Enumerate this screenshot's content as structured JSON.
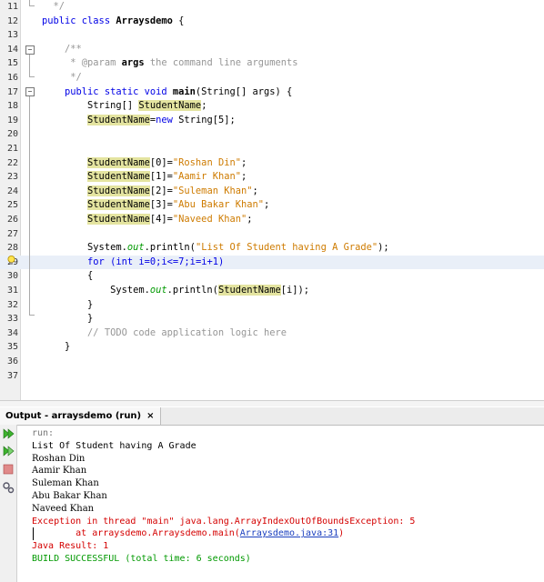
{
  "editor": {
    "lines": [
      {
        "n": "11",
        "parts": [
          {
            "t": "  */",
            "c": "com"
          }
        ]
      },
      {
        "n": "12",
        "parts": [
          {
            "t": "public class ",
            "c": "kw"
          },
          {
            "t": "Arraysdemo",
            "c": "bold"
          },
          {
            "t": " {",
            "c": ""
          }
        ]
      },
      {
        "n": "13",
        "parts": []
      },
      {
        "n": "14",
        "parts": [
          {
            "t": "    /**",
            "c": "com"
          }
        ]
      },
      {
        "n": "15",
        "parts": [
          {
            "t": "     * @param ",
            "c": "com"
          },
          {
            "t": "args",
            "c": "bold"
          },
          {
            "t": " the command line arguments",
            "c": "com"
          }
        ]
      },
      {
        "n": "16",
        "parts": [
          {
            "t": "     */",
            "c": "com"
          }
        ]
      },
      {
        "n": "17",
        "parts": [
          {
            "t": "    public static void ",
            "c": "kw"
          },
          {
            "t": "main",
            "c": "bold"
          },
          {
            "t": "(String[] args) {",
            "c": ""
          }
        ]
      },
      {
        "n": "18",
        "parts": [
          {
            "t": "        String[] ",
            "c": ""
          },
          {
            "t": "StudentName",
            "c": "var"
          },
          {
            "t": ";",
            "c": ""
          }
        ]
      },
      {
        "n": "19",
        "parts": [
          {
            "t": "        ",
            "c": ""
          },
          {
            "t": "StudentName",
            "c": "var"
          },
          {
            "t": "=",
            "c": ""
          },
          {
            "t": "new",
            "c": "kw"
          },
          {
            "t": " String[5];",
            "c": ""
          }
        ]
      },
      {
        "n": "20",
        "parts": []
      },
      {
        "n": "21",
        "parts": []
      },
      {
        "n": "22",
        "parts": [
          {
            "t": "        ",
            "c": ""
          },
          {
            "t": "StudentName",
            "c": "var"
          },
          {
            "t": "[0]=",
            "c": ""
          },
          {
            "t": "\"Roshan Din\"",
            "c": "str"
          },
          {
            "t": ";",
            "c": ""
          }
        ]
      },
      {
        "n": "23",
        "parts": [
          {
            "t": "        ",
            "c": ""
          },
          {
            "t": "StudentName",
            "c": "var"
          },
          {
            "t": "[1]=",
            "c": ""
          },
          {
            "t": "\"Aamir Khan\"",
            "c": "str"
          },
          {
            "t": ";",
            "c": ""
          }
        ]
      },
      {
        "n": "24",
        "parts": [
          {
            "t": "        ",
            "c": ""
          },
          {
            "t": "StudentName",
            "c": "var"
          },
          {
            "t": "[2]=",
            "c": ""
          },
          {
            "t": "\"Suleman Khan\"",
            "c": "str"
          },
          {
            "t": ";",
            "c": ""
          }
        ]
      },
      {
        "n": "25",
        "parts": [
          {
            "t": "        ",
            "c": ""
          },
          {
            "t": "StudentName",
            "c": "var"
          },
          {
            "t": "[3]=",
            "c": ""
          },
          {
            "t": "\"Abu Bakar Khan\"",
            "c": "str"
          },
          {
            "t": ";",
            "c": ""
          }
        ]
      },
      {
        "n": "26",
        "parts": [
          {
            "t": "        ",
            "c": ""
          },
          {
            "t": "StudentName",
            "c": "var"
          },
          {
            "t": "[4]=",
            "c": ""
          },
          {
            "t": "\"Naveed Khan\"",
            "c": "str"
          },
          {
            "t": ";",
            "c": ""
          }
        ]
      },
      {
        "n": "27",
        "parts": []
      },
      {
        "n": "28",
        "parts": [
          {
            "t": "        System.",
            "c": ""
          },
          {
            "t": "out",
            "c": "field"
          },
          {
            "t": ".println(",
            "c": ""
          },
          {
            "t": "\"List Of Student having A Grade\"",
            "c": "str"
          },
          {
            "t": ");",
            "c": ""
          }
        ]
      },
      {
        "n": "29",
        "parts": [
          {
            "t": "        ",
            "c": ""
          },
          {
            "t": "for",
            "c": "kw"
          },
          {
            "t": " (",
            "c": "kw"
          },
          {
            "t": "int",
            "c": "kw"
          },
          {
            "t": " i=0;i<=7;i=i+1)",
            "c": "kw"
          }
        ]
      },
      {
        "n": "30",
        "parts": [
          {
            "t": "        {",
            "c": ""
          }
        ]
      },
      {
        "n": "31",
        "parts": [
          {
            "t": "            System.",
            "c": ""
          },
          {
            "t": "out",
            "c": "field"
          },
          {
            "t": ".println(",
            "c": ""
          },
          {
            "t": "StudentName",
            "c": "var"
          },
          {
            "t": "[i]);",
            "c": ""
          }
        ]
      },
      {
        "n": "32",
        "parts": [
          {
            "t": "        }",
            "c": ""
          }
        ]
      },
      {
        "n": "33",
        "parts": [
          {
            "t": "        }",
            "c": ""
          }
        ]
      },
      {
        "n": "34",
        "parts": [
          {
            "t": "        // TODO code application logic here",
            "c": "com"
          }
        ]
      },
      {
        "n": "35",
        "parts": [
          {
            "t": "    }",
            "c": ""
          }
        ]
      },
      {
        "n": "36",
        "parts": []
      },
      {
        "n": "37",
        "parts": []
      }
    ],
    "highlighted_line": "29",
    "hint_bulb_line": "29"
  },
  "output": {
    "tab_prefix": "Output - ",
    "tab_project": "arraysdemo (run)",
    "close_glyph": "×",
    "lines": [
      {
        "t": "run:",
        "c": "out-gray"
      },
      {
        "t": "List Of Student having A Grade",
        "c": "out-mono"
      },
      {
        "t": "Roshan Din",
        "c": ""
      },
      {
        "t": "Aamir Khan",
        "c": ""
      },
      {
        "t": "Suleman Khan",
        "c": ""
      },
      {
        "t": "Abu Bakar Khan",
        "c": ""
      },
      {
        "t": "Naveed Khan",
        "c": ""
      },
      {
        "t": "Exception in thread \"main\" java.lang.ArrayIndexOutOfBoundsException: 5",
        "c": "out-red"
      },
      {
        "t": "        at arraysdemo.Arraysdemo.main(",
        "c": "out-red",
        "link": "Arraysdemo.java:31",
        "after": ")"
      },
      {
        "t": "Java Result: 1",
        "c": "out-red"
      },
      {
        "t": "BUILD SUCCESSFUL (total time: 6 seconds)",
        "c": "out-green"
      }
    ]
  },
  "colors": {
    "keyword": "#0000e6",
    "string": "#ce7b00",
    "comment": "#969696",
    "error": "#d40000",
    "success": "#009900",
    "highlight": "#e9eff8",
    "var_mark": "#e4e4a0"
  },
  "icons": [
    "fold-minus-icon",
    "lightbulb-hint-icon",
    "rerun-icon",
    "rerun-debug-icon",
    "stop-icon",
    "settings-icon"
  ]
}
